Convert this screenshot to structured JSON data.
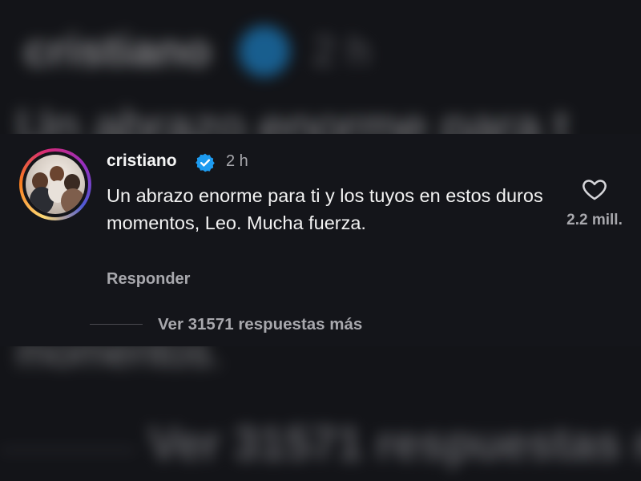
{
  "comment": {
    "username": "cristiano",
    "verified_icon": "verified-badge-icon",
    "timestamp": "2 h",
    "text": "Un abrazo enorme para ti y los tuyos en estos duros momentos, Leo. Mucha fuerza.",
    "reply_label": "Responder",
    "like_icon": "heart-outline-icon",
    "like_count": "2.2 mill.",
    "view_replies_label": "Ver 31571 respuestas más"
  },
  "background": {
    "username": "cristiano",
    "timestamp": "2 h",
    "text_fragment": "Un abrazo enorme para t",
    "text_fragment_2": "momentos.",
    "view_replies_fragment": "Ver 31571 respuestas m"
  },
  "colors": {
    "page_bg": "#131418",
    "card_bg": "#14151a",
    "text_primary": "#f2f2f2",
    "text_secondary": "#a8a8ad",
    "verified_blue": "#1d9bf0"
  }
}
